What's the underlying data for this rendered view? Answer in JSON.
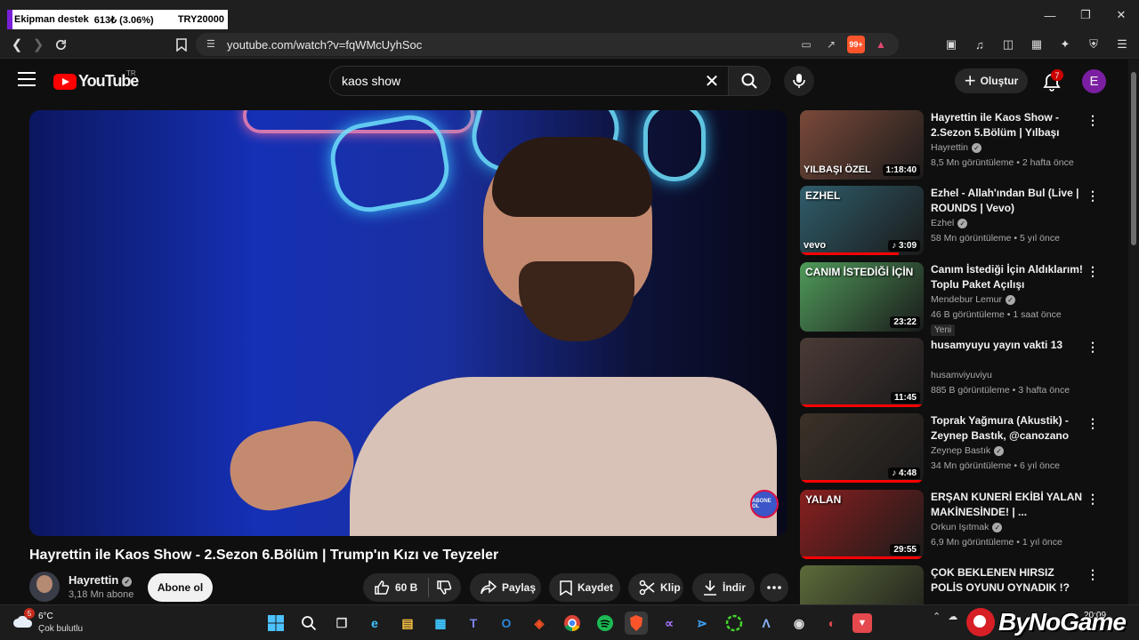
{
  "browser": {
    "ticker": {
      "label": "Ekipman destek",
      "amount": "613₺ (3.06%)",
      "target": "TRY20000"
    },
    "url": "youtube.com/watch?v=fqWMcUyhSoc",
    "brave_count": "99+"
  },
  "masthead": {
    "logo_text": "YouTube",
    "country_code": "TR",
    "search_value": "kaos show",
    "create_label": "Oluştur",
    "notifications_count": "7",
    "avatar_letter": "E"
  },
  "video": {
    "title": "Hayrettin ile Kaos Show - 2.Sezon 6.Bölüm | Trump'ın Kızı ve Teyzeler",
    "channel": "Hayrettin",
    "subscribers": "3,18 Mn abone",
    "subscribe_label": "Abone ol",
    "watermark_label": "ABONE OL",
    "actions": {
      "likes": "60 B",
      "share": "Paylaş",
      "save": "Kaydet",
      "clip": "Klip",
      "download": "İndir"
    }
  },
  "recommendations": [
    {
      "title": "Hayrettin ile Kaos Show - 2.Sezon 5.Bölüm | Yılbaşı Özel...",
      "channel": "Hayrettin",
      "verified": true,
      "meta": "8,5 Mn görüntüleme • 2 hafta önce",
      "duration": "1:18:40",
      "thumb_caption": "YILBAŞI ÖZEL",
      "thumb_top": "",
      "badge": "",
      "music": false,
      "progress": 0.0,
      "color": "#7a4a3a"
    },
    {
      "title": "Ezhel - Allah'ından Bul (Live | ROUNDS | Vevo)",
      "channel": "Ezhel",
      "verified": true,
      "meta": "58 Mn görüntüleme • 5 yıl önce",
      "duration": "3:09",
      "thumb_caption": "vevo",
      "thumb_top": "EZHEL",
      "badge": "",
      "music": true,
      "progress": 0.8,
      "color": "#2f5d6b"
    },
    {
      "title": "Canım İstediği İçin Aldıklarım! Toplu Paket Açılışı",
      "channel": "Mendebur Lemur",
      "verified": true,
      "meta": "46 B görüntüleme • 1 saat önce",
      "duration": "23:22",
      "thumb_caption": "",
      "thumb_top": "CANIM İSTEDİĞİ İÇİN",
      "badge": "Yeni",
      "music": false,
      "progress": 0.0,
      "color": "#4f9a5a"
    },
    {
      "title": "husamyuyu yayın vakti 13",
      "channel": "husamviyuviyu",
      "verified": false,
      "meta": "885 B görüntüleme • 3 hafta önce",
      "duration": "11:45",
      "thumb_caption": "",
      "thumb_top": "",
      "badge": "",
      "music": false,
      "progress": 1.0,
      "color": "#4a3a36"
    },
    {
      "title": "Toprak Yağmura (Akustik) - Zeynep Bastık, @canozano",
      "channel": "Zeynep Bastık",
      "verified": true,
      "meta": "34 Mn görüntüleme • 6 yıl önce",
      "duration": "4:48",
      "thumb_caption": "",
      "thumb_top": "",
      "badge": "",
      "music": true,
      "progress": 1.0,
      "color": "#3b3128"
    },
    {
      "title": "ERŞAN KUNERİ EKİBİ YALAN MAKİNESİNDE! | ...",
      "channel": "Orkun Işıtmak",
      "verified": true,
      "meta": "6,9 Mn görüntüleme • 1 yıl önce",
      "duration": "29:55",
      "thumb_caption": "",
      "thumb_top": "YALAN",
      "badge": "",
      "music": false,
      "progress": 1.0,
      "color": "#8a1f1f"
    },
    {
      "title": "ÇOK BEKLENEN HIRSIZ POLİS OYUNU OYNADIK !? @Sefa ...",
      "channel": "",
      "verified": false,
      "meta": "",
      "duration": "",
      "thumb_caption": "",
      "thumb_top": "",
      "badge": "",
      "music": false,
      "progress": 0.0,
      "color": "#5c6b3a"
    }
  ],
  "taskbar": {
    "weather_temp": "6°C",
    "weather_desc": "Çok bulutlu",
    "weather_badge": "5",
    "clock_time": "20:09",
    "watermark_text": "ByNoGame"
  }
}
